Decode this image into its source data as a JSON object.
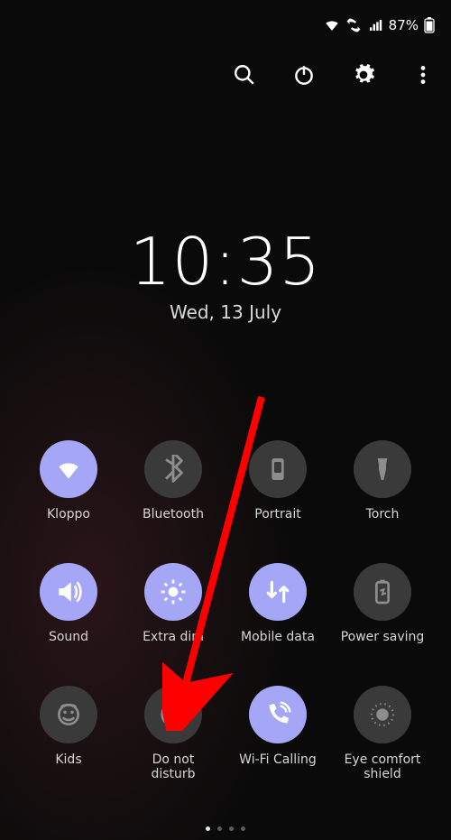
{
  "status": {
    "battery_percent": "87%"
  },
  "actions": {
    "search": "search",
    "power": "power",
    "settings": "settings",
    "more": "more"
  },
  "clock": {
    "time": "10:35",
    "date": "Wed, 13 July"
  },
  "tiles": [
    {
      "name": "wifi",
      "label": "Kloppo",
      "on": true,
      "icon": "wifi"
    },
    {
      "name": "bluetooth",
      "label": "Bluetooth",
      "on": false,
      "icon": "bluetooth"
    },
    {
      "name": "portrait",
      "label": "Portrait",
      "on": false,
      "icon": "portrait"
    },
    {
      "name": "torch",
      "label": "Torch",
      "on": false,
      "icon": "torch"
    },
    {
      "name": "sound",
      "label": "Sound",
      "on": true,
      "icon": "sound"
    },
    {
      "name": "extra-dim",
      "label": "Extra dim",
      "on": true,
      "icon": "extradim"
    },
    {
      "name": "mobile-data",
      "label": "Mobile data",
      "on": true,
      "icon": "data"
    },
    {
      "name": "power-saving",
      "label": "Power saving",
      "on": false,
      "icon": "battery"
    },
    {
      "name": "kids",
      "label": "Kids",
      "on": false,
      "icon": "kids"
    },
    {
      "name": "dnd",
      "label": "Do not disturb",
      "on": false,
      "icon": "dnd"
    },
    {
      "name": "wifi-calling",
      "label": "Wi-Fi Calling",
      "on": true,
      "icon": "wificall"
    },
    {
      "name": "eye-comfort",
      "label": "Eye comfort shield",
      "on": false,
      "icon": "eye"
    }
  ],
  "pages": {
    "count": 4,
    "active": 0
  },
  "arrow_target": "dnd"
}
